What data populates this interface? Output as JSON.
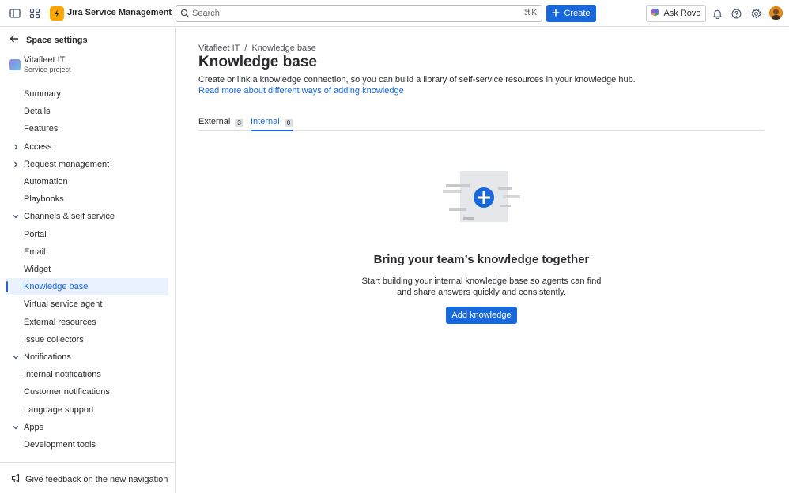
{
  "topbar": {
    "app_name": "Jira Service Management",
    "search_placeholder": "Search",
    "search_shortcut": "⌘K",
    "create_label": "Create",
    "ask_rovo_label": "Ask Rovo"
  },
  "sidebar": {
    "back_label": "Space settings",
    "project_name": "Vitafleet IT",
    "project_type": "Service project",
    "items": [
      {
        "label": "Summary",
        "chevron": ""
      },
      {
        "label": "Details",
        "chevron": ""
      },
      {
        "label": "Features",
        "chevron": ""
      },
      {
        "label": "Access",
        "chevron": "right"
      },
      {
        "label": "Request management",
        "chevron": "right"
      },
      {
        "label": "Automation",
        "chevron": ""
      },
      {
        "label": "Playbooks",
        "chevron": ""
      },
      {
        "label": "Channels & self service",
        "chevron": "down"
      },
      {
        "label": "Portal",
        "chevron": ""
      },
      {
        "label": "Email",
        "chevron": ""
      },
      {
        "label": "Widget",
        "chevron": ""
      },
      {
        "label": "Knowledge base",
        "chevron": "",
        "selected": true
      },
      {
        "label": "Virtual service agent",
        "chevron": ""
      },
      {
        "label": "External resources",
        "chevron": ""
      },
      {
        "label": "Issue collectors",
        "chevron": ""
      },
      {
        "label": "Notifications",
        "chevron": "down"
      },
      {
        "label": "Internal notifications",
        "chevron": ""
      },
      {
        "label": "Customer notifications",
        "chevron": ""
      },
      {
        "label": "Language support",
        "chevron": ""
      },
      {
        "label": "Apps",
        "chevron": "down"
      },
      {
        "label": "Development tools",
        "chevron": ""
      }
    ],
    "feedback_label": "Give feedback on the new navigation"
  },
  "main": {
    "breadcrumb": [
      "Vitafleet IT",
      "/",
      "Knowledge base"
    ],
    "title": "Knowledge base",
    "description": "Create or link a knowledge connection, so you can build a library of self-service resources in your knowledge hub.",
    "link": "Read more about different ways of adding knowledge",
    "tabs": [
      {
        "label": "External",
        "count": "3"
      },
      {
        "label": "Internal",
        "count": "0",
        "active": true
      }
    ],
    "empty_state": {
      "title": "Bring your team’s knowledge together",
      "description": "Start building your internal knowledge base so agents can find and share answers quickly and consistently.",
      "button": "Add knowledge"
    }
  },
  "colors": {
    "brand_blue": "#1868db",
    "jira_yellow": "#fca700",
    "selected_bg": "#e9f2fe"
  }
}
